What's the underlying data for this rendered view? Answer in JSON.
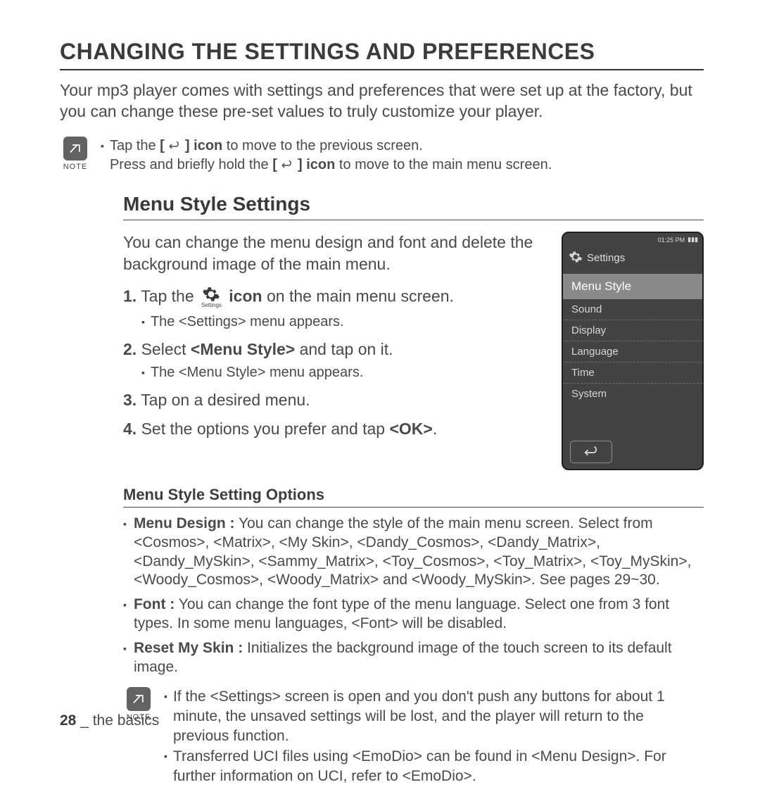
{
  "title": "CHANGING THE SETTINGS AND PREFERENCES",
  "intro": "Your mp3 player comes with settings and preferences that were set up at the factory, but you can change these pre-set values to truly customize your player.",
  "note_label": "NOTE",
  "note1_a_pre": "Tap the ",
  "note1_a_icon": "[ ",
  "note1_a_iconend": " ] icon",
  "note1_a_post": " to move to the previous screen.",
  "note1_b_pre": "Press and briefly hold the ",
  "note1_b_icon": "[ ",
  "note1_b_iconend": " ] icon",
  "note1_b_post": " to move to the main menu screen.",
  "subhead": "Menu Style Settings",
  "subintro": "You can change the menu design and font and delete the background image of the main menu.",
  "gear_label": "Settings",
  "step1_a": "1.",
  "step1_b": " Tap the ",
  "step1_c": " icon",
  "step1_d": " on the main menu screen.",
  "step1_sub": "The <Settings> menu appears.",
  "step2_a": "2.",
  "step2_b": " Select ",
  "step2_c": "<Menu Style>",
  "step2_d": " and tap on it.",
  "step2_sub": "The <Menu Style> menu appears.",
  "step3_a": "3.",
  "step3_b": " Tap on a desired menu.",
  "step4_a": "4.",
  "step4_b": " Set the options you prefer and tap ",
  "step4_c": "<OK>",
  "step4_d": ".",
  "device": {
    "time": "01:25 PM",
    "title": "Settings",
    "selected": "Menu Style",
    "items": [
      "Sound",
      "Display",
      "Language",
      "Time",
      "System"
    ]
  },
  "opthead": "Menu Style Setting Options",
  "opt1_label": "Menu Design :",
  "opt1_body": " You can change the style of the main menu screen. Select from <Cosmos>, <Matrix>, <My Skin>, <Dandy_Cosmos>, <Dandy_Matrix>, <Dandy_MySkin>, <Sammy_Matrix>, <Toy_Cosmos>, <Toy_Matrix>, <Toy_MySkin>, <Woody_Cosmos>, <Woody_Matrix> and <Woody_MySkin>. See pages 29~30.",
  "opt2_label": "Font :",
  "opt2_body": " You can change the font type of the menu language. Select one from 3 font types. In some menu languages, <Font> will be disabled.",
  "opt3_label": "Reset My Skin :",
  "opt3_body": " Initializes the background image of the touch screen to its default image.",
  "note2_a": "If the <Settings> screen is open and you don't push any buttons for about 1 minute, the unsaved settings will be lost, and the player will return to the previous function.",
  "note2_b": "Transferred UCI files using <EmoDio> can be found in <Menu Design>. For further information on UCI, refer to <EmoDio>.",
  "footer_num": "28",
  "footer_sep": " _ ",
  "footer_txt": "the basics"
}
